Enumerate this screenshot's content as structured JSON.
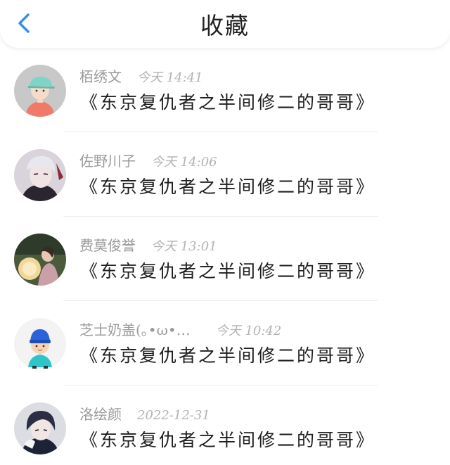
{
  "header": {
    "title": "收藏",
    "back_icon": "chevron-left-icon",
    "accent_color": "#2f8ff0"
  },
  "items": [
    {
      "name": "栢绣文",
      "time": "今天 14:41",
      "content": "《东京复仇者之半间修二的哥哥》",
      "avatar": "avatar-cartoon-cap"
    },
    {
      "name": "佐野川子",
      "time": "今天 14:06",
      "content": "《东京复仇者之半间修二的哥哥》",
      "avatar": "avatar-anime-white-hair"
    },
    {
      "name": "费莫俊誉",
      "time": "今天 13:01",
      "content": "《东京复仇者之半间修二的哥哥》",
      "avatar": "avatar-photo-lantern"
    },
    {
      "name": "芝士奶盖(｡•ω•…",
      "time": "今天 10:42",
      "content": "《东京复仇者之半间修二的哥哥》",
      "avatar": "avatar-cartoon-boy-beanie"
    },
    {
      "name": "洛绘颜",
      "time": "2022-12-31",
      "content": "《东京复仇者之半间修二的哥哥》",
      "avatar": "avatar-anime-dark-hair"
    }
  ]
}
